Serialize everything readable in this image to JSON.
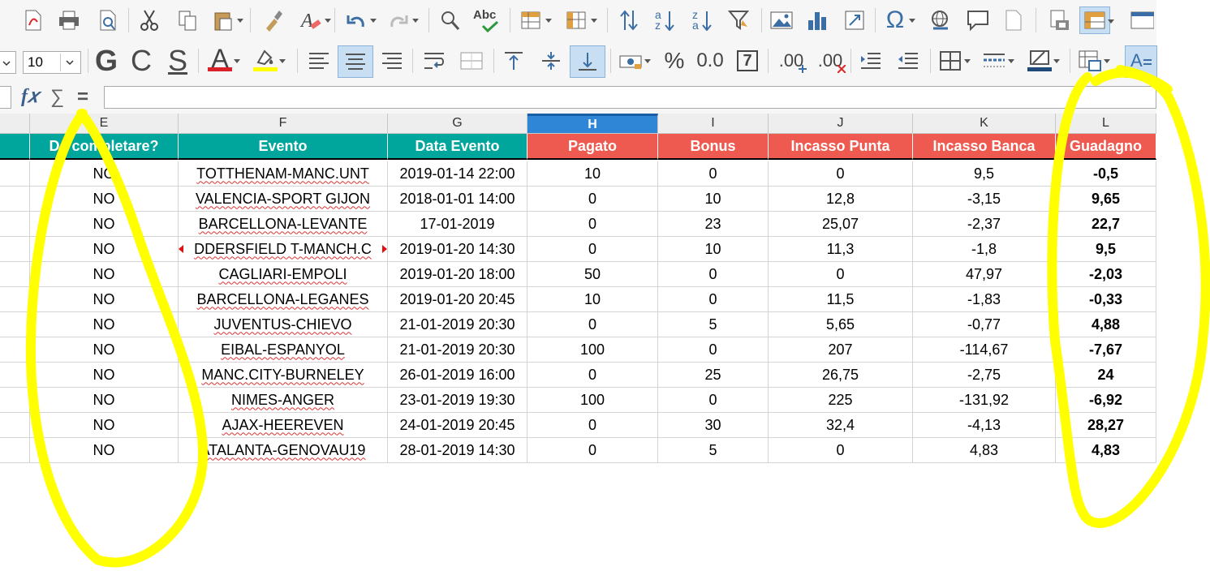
{
  "toolbar_row1": {
    "icons": [
      "export-pdf-icon",
      "print-icon",
      "print-preview-icon",
      "cut-icon",
      "copy-icon",
      "paste-icon",
      "clone-formatting-icon",
      "clear-formatting-icon",
      "undo-icon",
      "redo-icon",
      "find-replace-icon",
      "spelling-icon",
      "row-icon",
      "column-icon",
      "sort-icon",
      "sort-ascending-icon",
      "sort-descending-icon",
      "autofilter-icon",
      "image-icon",
      "chart-icon",
      "pivot-table-icon",
      "special-character-icon",
      "hyperlink-icon",
      "comment-icon",
      "header-footer-icon",
      "define-print-area-icon",
      "freeze-rows-columns-icon",
      "split-window-icon"
    ],
    "sort_asc_glyph": "az",
    "sort_desc_glyph": "za",
    "omega": "Ω",
    "abc": "Abc"
  },
  "toolbar_row2": {
    "font_size": "10",
    "bold": "G",
    "italic": "C",
    "underline": "S",
    "font_color_glyph": "A",
    "percent": "%",
    "number_format": "0.0",
    "date_glyph": "7",
    "add_decimal": ".00",
    "delete_decimal": ".00",
    "font_color_bar": "#d9212a",
    "highlight_bar": "#ffff00"
  },
  "formula_bar": {
    "fx": "f𝑥",
    "sum": "∑",
    "equals": "="
  },
  "sheet": {
    "columns": [
      {
        "letter": "E",
        "label": "Da completare?",
        "color": "teal"
      },
      {
        "letter": "F",
        "label": "Evento",
        "color": "teal"
      },
      {
        "letter": "G",
        "label": "Data Evento",
        "color": "teal"
      },
      {
        "letter": "H",
        "label": "Pagato",
        "color": "red"
      },
      {
        "letter": "I",
        "label": "Bonus",
        "color": "red"
      },
      {
        "letter": "J",
        "label": "Incasso Punta",
        "color": "red"
      },
      {
        "letter": "K",
        "label": "Incasso Banca",
        "color": "red"
      },
      {
        "letter": "L",
        "label": "Guadagno",
        "color": "red"
      }
    ],
    "rows": [
      [
        "NO",
        "TOTTHENAM-MANC.UNT",
        "2019-01-14 22:00",
        "10",
        "0",
        "0",
        "9,5",
        "-0,5"
      ],
      [
        "NO",
        "VALENCIA-SPORT GIJON",
        "2018-01-01 14:00",
        "0",
        "10",
        "12,8",
        "-3,15",
        "9,65"
      ],
      [
        "NO",
        "BARCELLONA-LEVANTE",
        "17-01-2019",
        "0",
        "23",
        "25,07",
        "-2,37",
        "22,7"
      ],
      [
        "NO",
        "DDERSFIELD T-MANCH.C",
        "2019-01-20 14:30",
        "0",
        "10",
        "11,3",
        "-1,8",
        "9,5"
      ],
      [
        "NO",
        "CAGLIARI-EMPOLI",
        "2019-01-20 18:00",
        "50",
        "0",
        "0",
        "47,97",
        "-2,03"
      ],
      [
        "NO",
        "BARCELLONA-LEGANES",
        "2019-01-20 20:45",
        "10",
        "0",
        "11,5",
        "-1,83",
        "-0,33"
      ],
      [
        "NO",
        "JUVENTUS-CHIEVO",
        "21-01-2019 20:30",
        "0",
        "5",
        "5,65",
        "-0,77",
        "4,88"
      ],
      [
        "NO",
        "EIBAL-ESPANYOL",
        "21-01-2019 20:30",
        "100",
        "0",
        "207",
        "-114,67",
        "-7,67"
      ],
      [
        "NO",
        "MANC.CITY-BURNELEY",
        "26-01-2019 16:00",
        "0",
        "25",
        "26,75",
        "-2,75",
        "24"
      ],
      [
        "NO",
        "NIMES-ANGER",
        "23-01-2019 19:30",
        "100",
        "0",
        "225",
        "-131,92",
        "-6,92"
      ],
      [
        "NO",
        "AJAX-HEEREVEN",
        "24-01-2019 20:45",
        "0",
        "30",
        "32,4",
        "-4,13",
        "28,27"
      ],
      [
        "NO",
        "ATALANTA-GENOVAU19",
        "28-01-2019 14:30",
        "0",
        "5",
        "0",
        "4,83",
        "4,83"
      ]
    ],
    "teal_color": "#00a69c",
    "red_color": "#ef5a50",
    "selected_column": "H"
  },
  "annotation": {
    "color": "#ffff00"
  }
}
